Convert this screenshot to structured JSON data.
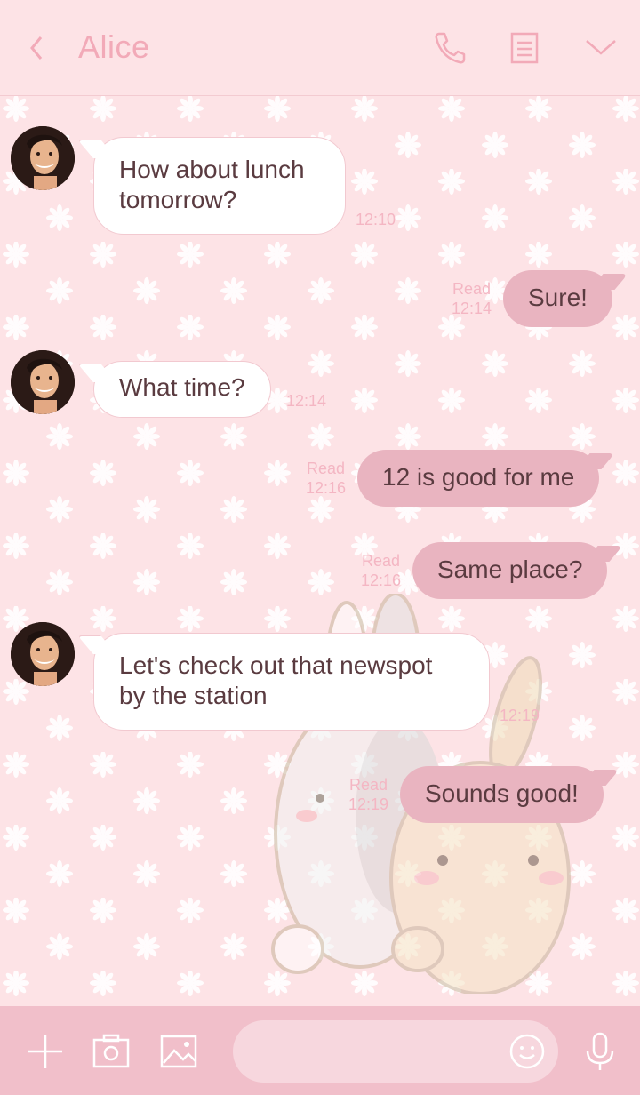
{
  "header": {
    "title": "Alice",
    "icons": [
      "back-chevron-icon",
      "phone-icon",
      "notes-icon",
      "chevron-down-icon"
    ]
  },
  "messages": [
    {
      "direction": "in",
      "text_line1": "How about lunch",
      "text_line2": "tomorrow?",
      "time": "12:10"
    },
    {
      "direction": "out",
      "text": "Sure!",
      "read": "Read",
      "time": "12:14"
    },
    {
      "direction": "in",
      "text": "What time?",
      "time": "12:14"
    },
    {
      "direction": "out",
      "text": "12 is good for me",
      "read": "Read",
      "time": "12:16"
    },
    {
      "direction": "out",
      "text": "Same place?",
      "read": "Read",
      "time": "12:16"
    },
    {
      "direction": "in",
      "text_line1": "Let's check out that newspot",
      "text_line2": "by the station",
      "time": "12:19"
    },
    {
      "direction": "out",
      "text": "Sounds good!",
      "read": "Read",
      "time": "12:19"
    }
  ],
  "footer": {
    "input_value": "",
    "icons": [
      "plus-icon",
      "camera-icon",
      "image-icon",
      "emoji-icon",
      "microphone-icon"
    ]
  },
  "colors": {
    "background": "#fde3e6",
    "header_text": "#f2aab8",
    "incoming_bubble": "#ffffff",
    "outgoing_bubble": "#e9b4c0",
    "timestamp": "#f4b6c3",
    "footer": "#f1bfca"
  }
}
